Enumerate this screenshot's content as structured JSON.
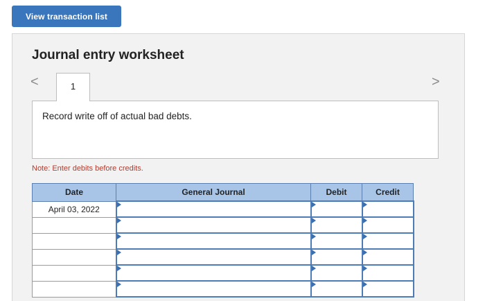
{
  "top_button": {
    "label": "View transaction list"
  },
  "worksheet": {
    "title": "Journal entry worksheet",
    "tab_label": "1",
    "prev_glyph": "<",
    "next_glyph": ">",
    "description": "Record write off of actual bad debts.",
    "note": "Note: Enter debits before credits."
  },
  "table": {
    "headers": {
      "date": "Date",
      "journal": "General Journal",
      "debit": "Debit",
      "credit": "Credit"
    },
    "rows": [
      {
        "date": "April 03, 2022",
        "journal": "",
        "debit": "",
        "credit": ""
      },
      {
        "date": "",
        "journal": "",
        "debit": "",
        "credit": ""
      },
      {
        "date": "",
        "journal": "",
        "debit": "",
        "credit": ""
      },
      {
        "date": "",
        "journal": "",
        "debit": "",
        "credit": ""
      },
      {
        "date": "",
        "journal": "",
        "debit": "",
        "credit": ""
      },
      {
        "date": "",
        "journal": "",
        "debit": "",
        "credit": ""
      }
    ]
  }
}
